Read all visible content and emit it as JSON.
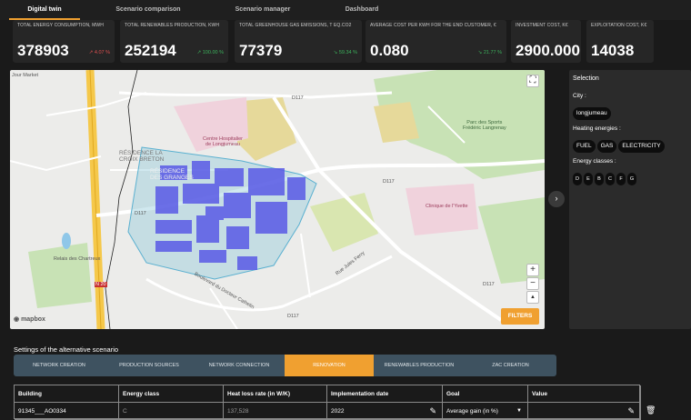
{
  "nav": {
    "tabs": [
      {
        "label": "Digital twin"
      },
      {
        "label": "Scenario comparison"
      },
      {
        "label": "Scenario manager"
      },
      {
        "label": "Dashboard"
      }
    ]
  },
  "kpis": [
    {
      "label": "TOTAL ENERGY CONSUMPTION, MWH",
      "value": "378903",
      "delta": "4.07 %"
    },
    {
      "label": "TOTAL RENEWABLES PRODUCTION, KWH",
      "value": "252194",
      "delta": "100.00 %"
    },
    {
      "label": "TOTAL GREENHOUSE GAS EMISSIONS, T EQ.CO2",
      "value": "77379",
      "delta": "59.34 %"
    },
    {
      "label": "AVERAGE COST PER KWH FOR THE END CUSTOMER, €",
      "value": "0.080",
      "delta": "21.77 %"
    },
    {
      "label": "INVESTMENT COST, K€",
      "value": "2900.000",
      "delta": ""
    },
    {
      "label": "EXPLOITATION COST, K€",
      "value": "14038",
      "delta": ""
    }
  ],
  "map": {
    "labels": {
      "market": "Jour Market",
      "hospital": "Centre Hospitalier\nde Longjumeau",
      "hospital1": "Centre Hospitalier",
      "hospital2": "de Longjumeau",
      "residence1": "RÉSIDENCE LA",
      "residence2": "CROIX BRETON",
      "residence3": "RÉSIDENCE",
      "residence4": "DES GRANGES",
      "parc1": "Parc des Sports",
      "parc2": "Frédéric Langrenay",
      "clinic": "Clinique de l'Yvette",
      "relais": "Relais des Chartreux",
      "road_ferry": "Rue Jules Ferry",
      "road_docteur": "Boulevard du Docteur Cathelin",
      "road_d117a": "D117",
      "road_d117b": "D117",
      "road_d117c": "D117",
      "road_d117d": "D117",
      "road_d117e": "D117",
      "road_n20": "N 20"
    },
    "filters_label": "FILTERS",
    "attribution": "mapbox",
    "zoom_in": "+",
    "zoom_out": "−",
    "compass": "▲"
  },
  "selection": {
    "title": "Selection",
    "city_label": "City :",
    "city_value": "longjumeau",
    "heating_label": "Heating energies :",
    "heating": [
      "FUEL",
      "GAS",
      "ELECTRICITY"
    ],
    "classes_label": "Energy classes :",
    "classes": [
      "D",
      "E",
      "B",
      "C",
      "F",
      "G"
    ]
  },
  "settings": {
    "title": "Settings of the alternative scenario",
    "tabs": [
      {
        "label": "NETWORK CREATION"
      },
      {
        "label": "PRODUCTION SOURCES"
      },
      {
        "label": "NETWORK CONNECTION"
      },
      {
        "label": "RENOVATION"
      },
      {
        "label": "RENEWABLES PRODUCTION"
      },
      {
        "label": "ZAC CREATION"
      }
    ],
    "columns": [
      "Building",
      "Energy class",
      "Heat loss rate (in W/K)",
      "Implementation date",
      "Goal",
      "Value"
    ],
    "row": {
      "building": "91345___AO0334",
      "energy_class": "C",
      "heat_loss": "137,528",
      "date": "2022",
      "goal": "Average gain (in %)",
      "value": ""
    }
  }
}
